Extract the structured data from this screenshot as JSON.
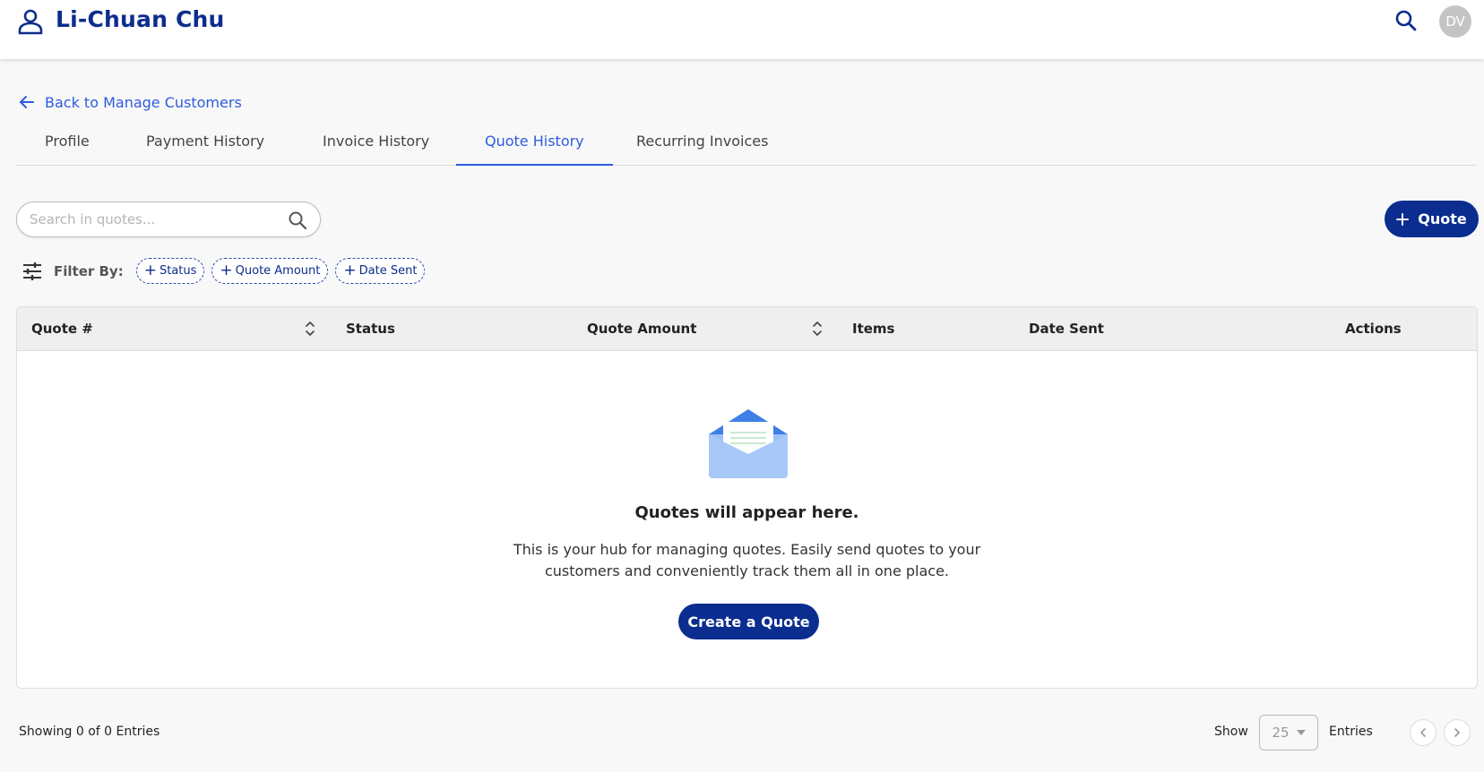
{
  "header": {
    "title": "Li-Chuan Chu",
    "avatar_initials": "DV",
    "person_icon": "person-icon",
    "search_icon": "search-icon"
  },
  "back_link": {
    "label": "Back to Manage Customers",
    "icon": "arrow-left-icon"
  },
  "tabs": [
    {
      "label": "Profile",
      "active": false
    },
    {
      "label": "Payment History",
      "active": false
    },
    {
      "label": "Invoice History",
      "active": false
    },
    {
      "label": "Quote History",
      "active": true
    },
    {
      "label": "Recurring Invoices",
      "active": false
    }
  ],
  "search": {
    "placeholder": "Search in quotes...",
    "value": ""
  },
  "add_quote_button": {
    "label": "Quote",
    "icon": "plus-icon"
  },
  "filters": {
    "label": "Filter By:",
    "icon": "sliders-icon",
    "chips": [
      "Status",
      "Quote Amount",
      "Date Sent"
    ]
  },
  "table": {
    "columns": [
      {
        "label": "Quote #",
        "sortable": true
      },
      {
        "label": "Status",
        "sortable": false
      },
      {
        "label": "Quote Amount",
        "sortable": true
      },
      {
        "label": "Items",
        "sortable": false
      },
      {
        "label": "Date Sent",
        "sortable": false
      },
      {
        "label": "Actions",
        "sortable": false
      }
    ],
    "rows": []
  },
  "empty_state": {
    "icon": "envelope-icon",
    "title": "Quotes will appear here.",
    "description_line1": "This is your hub for managing quotes. Easily send quotes to your",
    "description_line2": "customers and conveniently track them all in one place.",
    "button_label": "Create a Quote"
  },
  "footer": {
    "showing_text": "Showing 0 of 0 Entries",
    "show_label": "Show",
    "page_size": "25",
    "entries_label": "Entries"
  },
  "colors": {
    "brand_navy": "#0a2d8f",
    "link_blue": "#2f5ae0",
    "title_navy": "#0d2d8c"
  }
}
